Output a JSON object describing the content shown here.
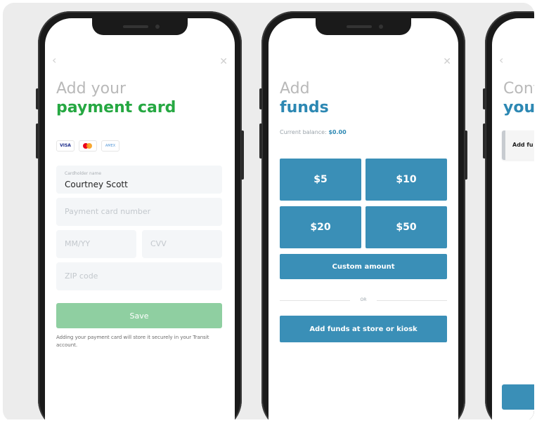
{
  "colors": {
    "green": "#26a842",
    "blue": "#2d88b3",
    "tile": "#3a8fb7"
  },
  "screen1": {
    "back_icon": "chevron-left-icon",
    "close_icon": "close-icon",
    "title_line1": "Add your",
    "title_line2": "payment card",
    "card_logos": [
      "VISA",
      "mastercard",
      "AMEX"
    ],
    "cardholder_label": "Cardholder name",
    "cardholder_value": "Courtney Scott",
    "card_number_placeholder": "Payment card number",
    "expiry_placeholder": "MM/YY",
    "cvv_placeholder": "CVV",
    "zip_placeholder": "ZIP code",
    "save_label": "Save",
    "note": "Adding your payment card will store it securely in your Transit account."
  },
  "screen2": {
    "close_icon": "close-icon",
    "title_line1": "Add",
    "title_line2": "funds",
    "balance_label": "Current balance:",
    "balance_value": "$0.00",
    "amounts": [
      "$5",
      "$10",
      "$20",
      "$50"
    ],
    "custom_label": "Custom amount",
    "or_label": "OR",
    "store_label": "Add funds at store or kiosk"
  },
  "screen3": {
    "back_icon": "chevron-left-icon",
    "title_line1": "Conf",
    "title_line2": "your",
    "row_label": "Add fu"
  }
}
